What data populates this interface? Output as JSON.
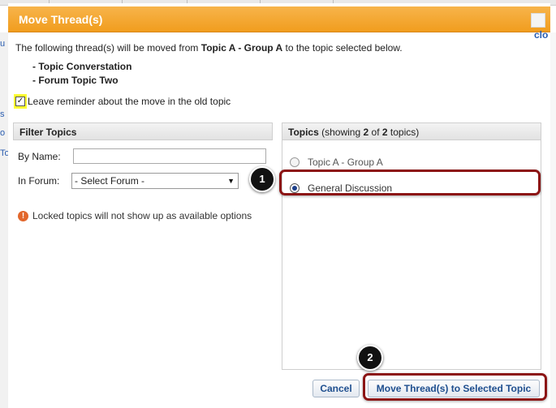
{
  "background": {
    "left_letters": [
      "u",
      "s",
      "o",
      "To"
    ],
    "close_link": "clo"
  },
  "dialog": {
    "title": "Move Thread(s)",
    "title_color": "#f19d1e",
    "intro": {
      "prefix": "The following thread(s) will be moved from",
      "source": "Topic A - Group A",
      "suffix": "to the topic selected below."
    },
    "threads": [
      "- Topic Converstation",
      "- Forum Topic Two"
    ],
    "reminder": {
      "checked": true,
      "label": "Leave reminder about the move in the old topic"
    },
    "filter": {
      "heading": "Filter Topics",
      "by_name_label": "By Name:",
      "by_name_value": "",
      "in_forum_label": "In Forum:",
      "forum_selected": "- Select Forum -",
      "warning": "Locked topics will not show up as available options"
    },
    "topics": {
      "heading_prefix": "Topics",
      "heading_showing": "(showing",
      "shown_count": "2",
      "heading_of": "of",
      "total_count": "2",
      "heading_suffix": "topics)",
      "options": [
        {
          "label": "Topic A - Group A",
          "selected": false
        },
        {
          "label": "General Discussion",
          "selected": true
        }
      ]
    },
    "buttons": {
      "cancel": "Cancel",
      "move": "Move Thread(s) to Selected Topic"
    }
  },
  "annotations": {
    "badge_1": "1",
    "badge_2": "2",
    "highlight_color": "#8c1515"
  }
}
